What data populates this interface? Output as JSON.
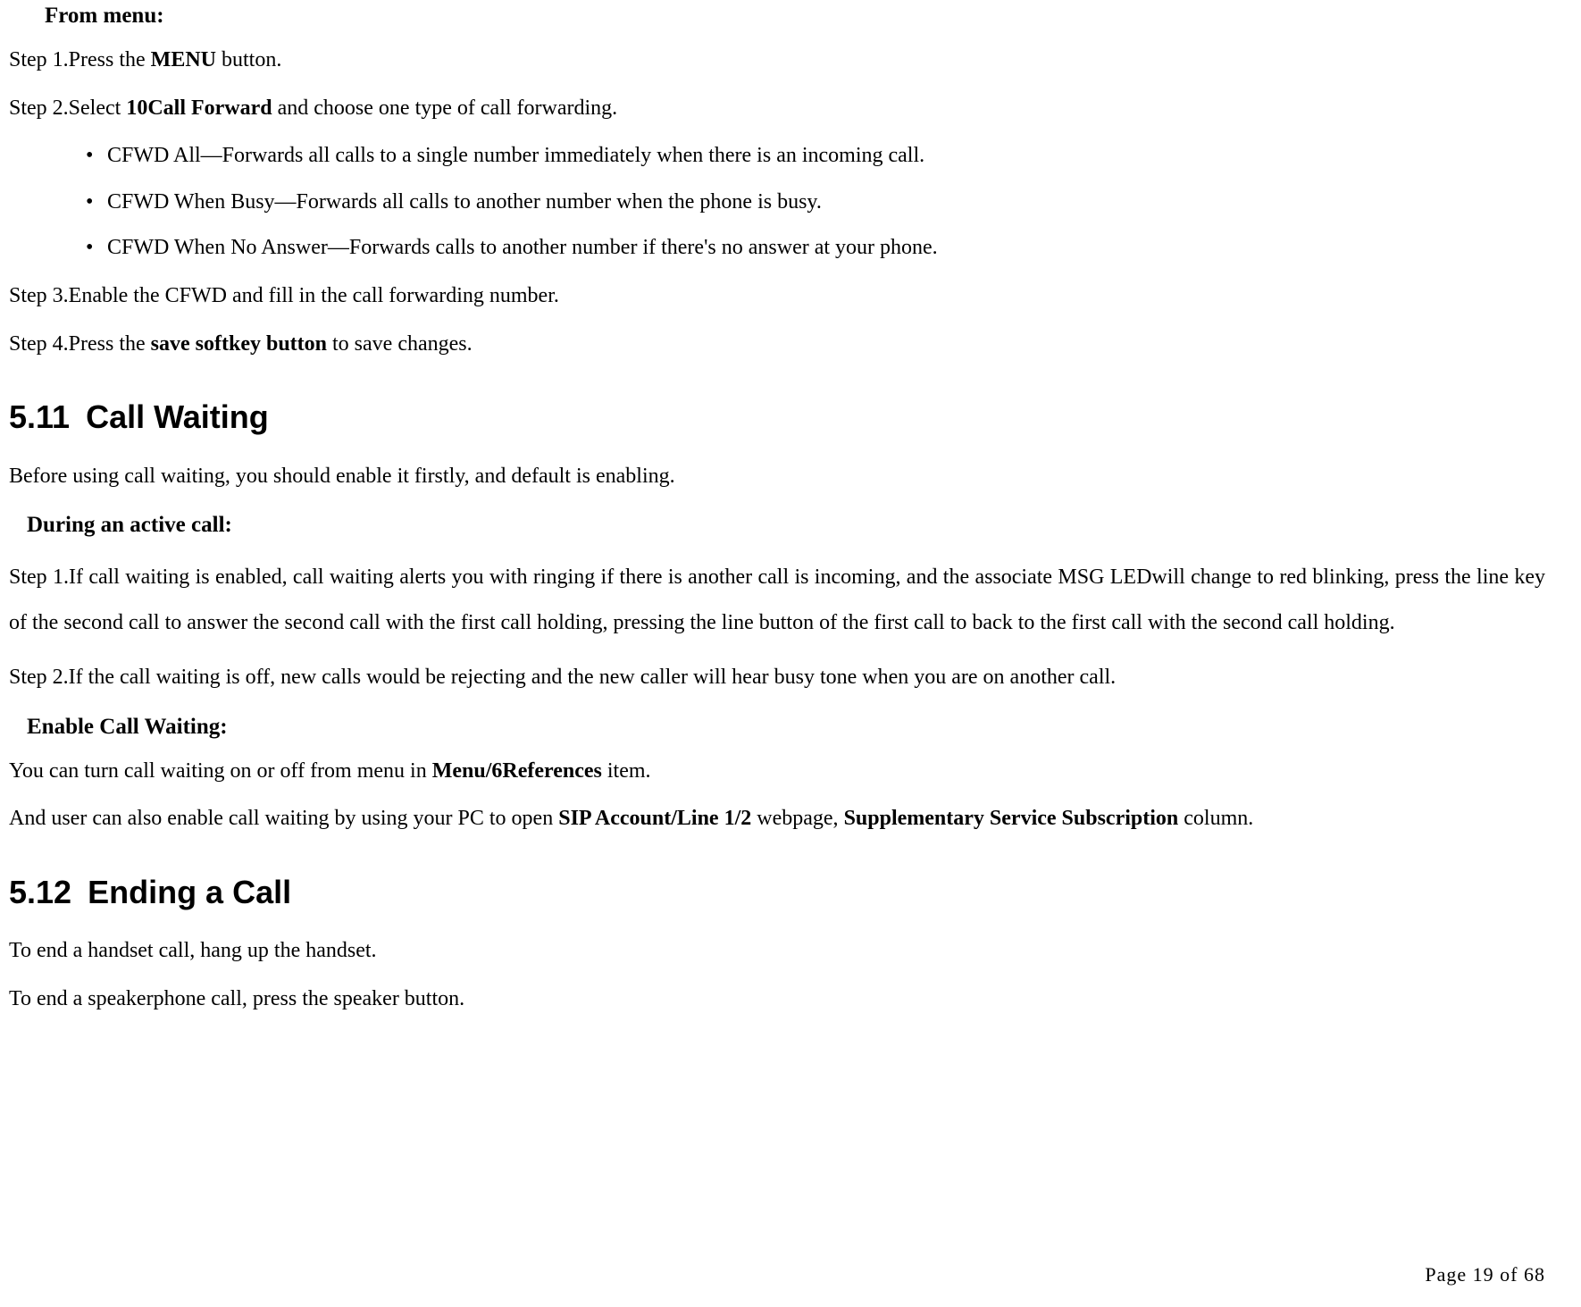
{
  "fromMenuHeading": "From menu:",
  "step1_prefix": "Step 1.Press the ",
  "step1_bold": "MENU",
  "step1_suffix": " button.",
  "step2_prefix": "Step 2.Select ",
  "step2_bold": "10Call Forward",
  "step2_suffix": " and choose one type of call forwarding.",
  "bullet1": "CFWD All—Forwards all calls to a single number immediately when there is an incoming call.",
  "bullet2": "CFWD When Busy—Forwards all calls to another number when the phone is busy.",
  "bullet3": "CFWD When No Answer—Forwards calls to another number if there's no answer at your phone.",
  "step3": "Step 3.Enable the CFWD and fill in the call forwarding number.",
  "step4_prefix": "Step 4.Press the ",
  "step4_bold": "save softkey button",
  "step4_suffix": " to save changes.",
  "sec511_num": "5.11",
  "sec511_title": "Call Waiting",
  "cw_intro": "Before using call waiting, you should enable it firstly, and default is enabling.",
  "during_heading": "During an active call:",
  "cw_step1": "Step 1.If call waiting is enabled, call waiting alerts you with ringing if there is another call is incoming, and the associate MSG LEDwill change to red blinking, press the line key of the second call to answer the second call with the first call holding, pressing the line button of the first call to back to the first call with the second call holding.",
  "cw_step2": "Step 2.If the call waiting is off, new calls would be rejecting and the new caller will hear busy tone when you are on another call.",
  "enable_heading": "Enable Call Waiting:",
  "en1_prefix": "You can turn call waiting on or off from menu in ",
  "en1_bold": "Menu/6References",
  "en1_suffix": " item.",
  "en2_prefix": "And user can also enable call waiting by using your PC to open ",
  "en2_bold1": "SIP Account/Line 1/2",
  "en2_mid": " webpage, ",
  "en2_bold2": "Supplementary Service Subscription",
  "en2_suffix": " column.",
  "sec512_num": "5.12",
  "sec512_title": "Ending a Call",
  "end1": "To end a handset call, hang up the handset.",
  "end2": "To end a speakerphone call, press the speaker button.",
  "footer": "Page 19 of 68"
}
